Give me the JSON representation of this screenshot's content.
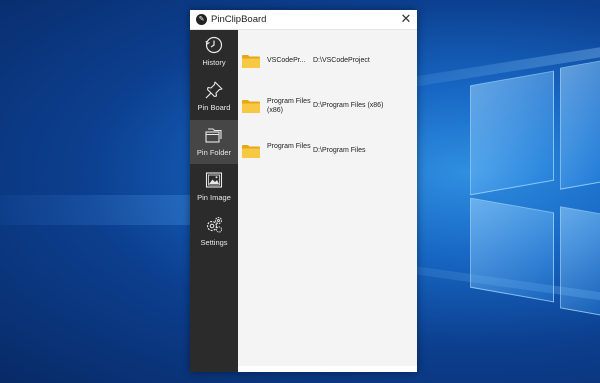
{
  "window": {
    "title": "PinClipBoard",
    "close_glyph": "✕"
  },
  "sidebar": {
    "items": [
      {
        "label": "History",
        "icon": "history-clock-icon"
      },
      {
        "label": "Pin Board",
        "icon": "pushpin-icon"
      },
      {
        "label": "Pin Folder",
        "icon": "folders-icon",
        "active": true
      },
      {
        "label": "Pin Image",
        "icon": "image-icon"
      },
      {
        "label": "Settings",
        "icon": "gears-icon"
      }
    ]
  },
  "folders": [
    {
      "name": "VSCodePr...",
      "path": "D:\\VSCodeProject"
    },
    {
      "name": "Program Files (x86)",
      "path": "D:\\Program Files (x86)"
    },
    {
      "name": "Program Files",
      "path": "D:\\Program Files"
    }
  ],
  "colors": {
    "sidebar": "#2b2b2b",
    "sidebar_active": "#464646",
    "content_bg": "#f4f4f4",
    "folder_yellow": "#f3c332"
  }
}
